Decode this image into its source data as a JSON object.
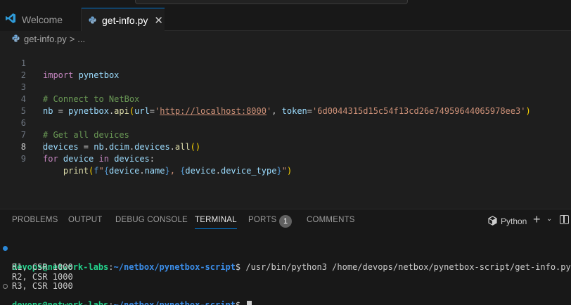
{
  "tabs": {
    "welcome_label": "Welcome",
    "active_label": "get-info.py"
  },
  "breadcrumb": {
    "file": "get-info.py",
    "sep": ">",
    "more": "..."
  },
  "editor": {
    "current_line": 8,
    "line_numbers": [
      "1",
      "2",
      "3",
      "4",
      "5",
      "6",
      "7",
      "8",
      "9"
    ],
    "lines": {
      "l1": {
        "kw": "import",
        "mod": "pynetbox"
      },
      "l3": {
        "comment": "# Connect to NetBox"
      },
      "l4": {
        "var": "nb",
        "eq": " = ",
        "mod": "pynetbox",
        "dot": ".",
        "fn": "api",
        "open": "(",
        "p1": "url",
        "eq1": "=",
        "q1": "'",
        "url": "http://localhost:8000",
        "q1b": "'",
        "comma": ", ",
        "p2": "token",
        "eq2": "=",
        "token": "'6d0044315d15c54f13cd26e74959644065978ee3'",
        "close": ")"
      },
      "l6": {
        "comment": "# Get all devices"
      },
      "l7": {
        "var": "devices",
        "eq": " = ",
        "obj": "nb",
        "d1": ".",
        "a1": "dcim",
        "d2": ".",
        "a2": "devices",
        "d3": ".",
        "fn": "all",
        "parens": "()"
      },
      "l8": {
        "for": "for",
        "var": "device",
        "in": "in",
        "iter": "devices",
        "colon": ":"
      },
      "l9": {
        "indent": "    ",
        "fn": "print",
        "open": "(",
        "fpre": "f",
        "q": "\"",
        "b1o": "{",
        "e1a": "device",
        "e1d": ".",
        "e1b": "name",
        "b1c": "}",
        "mid": ", ",
        "b2o": "{",
        "e2a": "device",
        "e2d": ".",
        "e2b": "device_type",
        "b2c": "}",
        "qc": "\"",
        "close": ")"
      }
    }
  },
  "panel": {
    "tabs": [
      "PROBLEMS",
      "OUTPUT",
      "DEBUG CONSOLE",
      "TERMINAL",
      "PORTS",
      "COMMENTS"
    ],
    "ports_count": "1",
    "terminal_name": "Python",
    "plus": "+",
    "chevron": "⌄"
  },
  "terminal": {
    "prompt_user": "devops@network-labs",
    "prompt_colon": ":",
    "prompt_path": "~/netbox/pynetbox-script",
    "prompt_symbol": "$ ",
    "command": "/usr/bin/python3 /home/devops/netbox/pynetbox-script/get-info.py",
    "output": [
      "R1, CSR 1000",
      "R2, CSR 1000",
      "R3, CSR 1000"
    ]
  },
  "colors": {
    "accent": "#0078d4",
    "prompt_user": "#23d18b",
    "prompt_path": "#3b8eea"
  },
  "icons": [
    "vscode-logo-icon",
    "python-file-icon",
    "close-icon",
    "python-icon",
    "plus-icon",
    "chevron-down-icon",
    "split-panel-icon"
  ]
}
